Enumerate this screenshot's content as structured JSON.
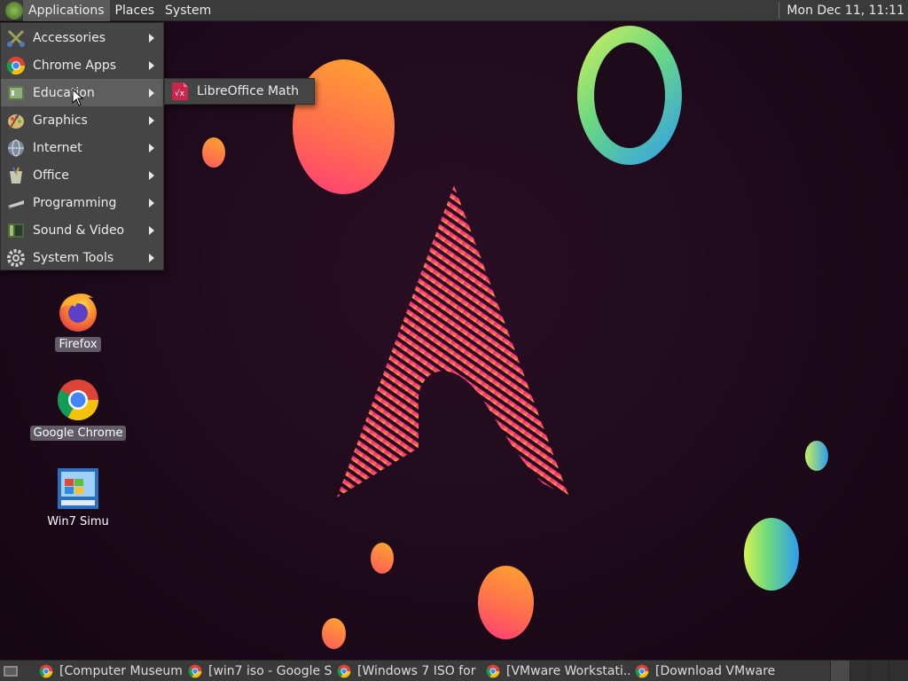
{
  "top_panel": {
    "menus": [
      "Applications",
      "Places",
      "System"
    ],
    "clock": "Mon Dec 11, 11:11"
  },
  "apps_menu": {
    "items": [
      {
        "label": "Accessories",
        "icon": "accessories-icon"
      },
      {
        "label": "Chrome Apps",
        "icon": "chrome-icon"
      },
      {
        "label": "Education",
        "icon": "education-icon"
      },
      {
        "label": "Graphics",
        "icon": "graphics-icon"
      },
      {
        "label": "Internet",
        "icon": "internet-icon"
      },
      {
        "label": "Office",
        "icon": "office-icon"
      },
      {
        "label": "Programming",
        "icon": "programming-icon"
      },
      {
        "label": "Sound & Video",
        "icon": "sound-video-icon"
      },
      {
        "label": "System Tools",
        "icon": "system-tools-icon"
      }
    ],
    "hovered": "Education"
  },
  "submenu": {
    "items": [
      {
        "label": "LibreOffice Math",
        "icon": "libreoffice-math-icon"
      }
    ]
  },
  "desktop_icons": [
    {
      "label": "Firefox",
      "icon": "firefox-icon"
    },
    {
      "label": "Google Chrome",
      "icon": "chrome-icon"
    },
    {
      "label": "Win7 Simu",
      "icon": "win7-simu-icon"
    }
  ],
  "taskbar": {
    "tasks": [
      {
        "label": "[Computer Museum..."
      },
      {
        "label": "[win7 iso - Google S..."
      },
      {
        "label": "[Windows 7 ISO for ..."
      },
      {
        "label": "[VMware Workstati..."
      },
      {
        "label": "[Download VMware ..."
      }
    ]
  },
  "colors": {
    "panel": "#3b3b3b",
    "menu_bg": "#454545",
    "menu_hover": "#5e5e5e",
    "wallpaper": "#1d0a1a",
    "accent_pink": "#ff2e8a",
    "accent_orange": "#ffa030"
  }
}
